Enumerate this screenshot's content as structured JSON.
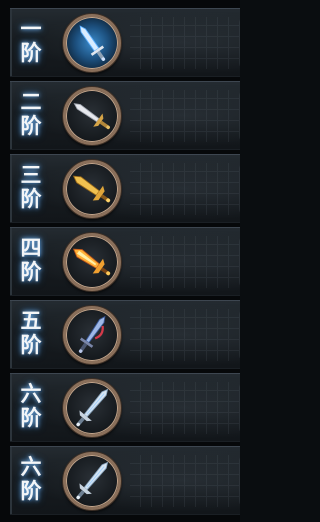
{
  "tiers": [
    {
      "label_top": "一",
      "label_bottom": "阶",
      "weapon_icon": "sword-blue-icon",
      "slot_glow": true
    },
    {
      "label_top": "二",
      "label_bottom": "阶",
      "weapon_icon": "sword-silver-gold-icon",
      "slot_glow": false
    },
    {
      "label_top": "三",
      "label_bottom": "阶",
      "weapon_icon": "sword-gold-icon",
      "slot_glow": false
    },
    {
      "label_top": "四",
      "label_bottom": "阶",
      "weapon_icon": "sword-flame-gold-icon",
      "slot_glow": false
    },
    {
      "label_top": "五",
      "label_bottom": "阶",
      "weapon_icon": "sword-blue-red-icon",
      "slot_glow": false
    },
    {
      "label_top": "六",
      "label_bottom": "阶",
      "weapon_icon": "sword-silver-long-icon",
      "slot_glow": false
    },
    {
      "label_top": "六",
      "label_bottom": "阶",
      "weapon_icon": "sword-silver-long-icon",
      "slot_glow": false
    }
  ],
  "colors": {
    "label_glow": "#2d6fb3",
    "frame_bronze": "#8a6f5a",
    "panel_dark": "#171c20"
  }
}
